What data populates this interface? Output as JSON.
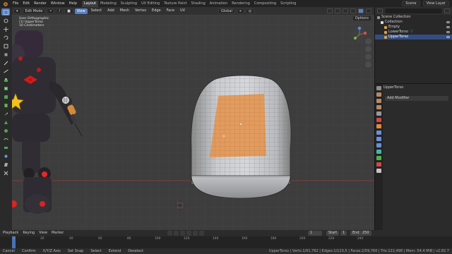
{
  "app": {
    "menus": [
      "File",
      "Edit",
      "Render",
      "Window",
      "Help"
    ],
    "workspaces": [
      "Layout",
      "Modeling",
      "Sculpting",
      "UV Editing",
      "Texture Paint",
      "Shading",
      "Animation",
      "Rendering",
      "Compositing",
      "Scripting"
    ],
    "active_workspace": "Layout",
    "scene": "Scene",
    "view_layer": "View Layer"
  },
  "viewport_header": {
    "mode": "Edit Mode",
    "menus": [
      "View",
      "Select",
      "Add",
      "Mesh",
      "Vertex",
      "Edge",
      "Face",
      "UV"
    ],
    "transform_orientation": "Global",
    "options": "Options"
  },
  "viewport_overlay": {
    "line1": "User Orthographic",
    "line2": "(1) UpperTorso",
    "line3": "10 Centimeters"
  },
  "outliner": {
    "items": [
      {
        "label": "Scene Collection",
        "selected": false
      },
      {
        "label": "Collection",
        "selected": false
      },
      {
        "label": "Empty",
        "selected": false
      },
      {
        "label": "LowerTorso",
        "selected": false
      },
      {
        "label": "UpperTorso",
        "selected": true
      }
    ]
  },
  "properties": {
    "object_name": "UpperTorso",
    "add_modifier": "Add Modifier"
  },
  "timeline": {
    "menus": [
      "Playback",
      "Keying",
      "View",
      "Marker"
    ],
    "current_frame": "1",
    "start_label": "Start",
    "start": "1",
    "end_label": "End",
    "end": "250",
    "ticks": [
      "0",
      "20",
      "40",
      "60",
      "80",
      "100",
      "120",
      "140",
      "160",
      "180",
      "200",
      "220",
      "240"
    ]
  },
  "status": {
    "items": [
      "Cancel",
      "Confirm",
      "X/Y/Z Axis",
      "Set Snap",
      "Select",
      "Extend",
      "Deselect"
    ],
    "right": "UpperTorso | Verts:1/61,762 | Edges:1/123,5 | Faces:2/59,760 | Tris:122,498 | Mem: 54.4 MiB | v2.82.7"
  },
  "colors": {
    "accent": "#5680c2",
    "face_selection": "#e5944f",
    "x_axis_line": "#9b3a3a"
  }
}
